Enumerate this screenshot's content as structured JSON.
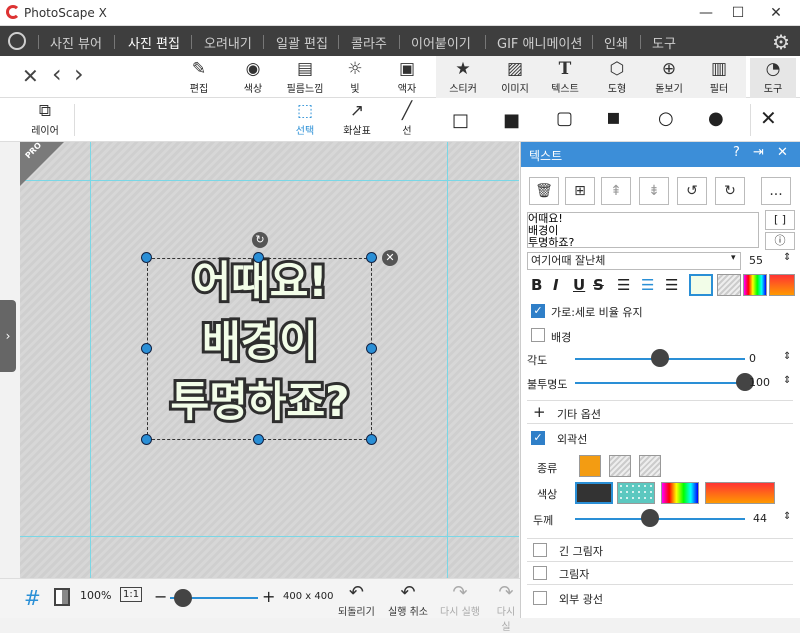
{
  "app": {
    "title": "PhotoScape X",
    "window": {
      "minimize": "—",
      "maximize": "☐",
      "close": "✕"
    }
  },
  "menu": {
    "items": [
      "사진 뷰어",
      "사진 편집",
      "오려내기",
      "일괄 편집",
      "콜라주",
      "이어붙이기",
      "GIF 애니메이션",
      "인쇄",
      "도구"
    ],
    "active": "사진 편집"
  },
  "toolbar": {
    "nav": {
      "close": "✕",
      "back": "‹",
      "forward": "›"
    },
    "tools": [
      {
        "label": "편집",
        "icon": "✎"
      },
      {
        "label": "색상",
        "icon": "◉"
      },
      {
        "label": "필름느낌",
        "icon": "▤"
      },
      {
        "label": "빛",
        "icon": "☼"
      },
      {
        "label": "액자",
        "icon": "▣"
      },
      {
        "label": "스티커",
        "icon": "★"
      },
      {
        "label": "이미지",
        "icon": "▨"
      },
      {
        "label": "텍스트",
        "icon": "T"
      },
      {
        "label": "도형",
        "icon": "⬡"
      },
      {
        "label": "돋보기",
        "icon": "⊕"
      },
      {
        "label": "필터",
        "icon": "▥"
      },
      {
        "label": "도구",
        "icon": "◔"
      }
    ]
  },
  "toolbar2": {
    "layer": "레이어",
    "select": "선택",
    "arrow": "화살표",
    "line": "선",
    "shapes": [
      "□",
      "■",
      "▢",
      "▪",
      "○",
      "●"
    ],
    "close": "✕"
  },
  "canvas": {
    "badge": "PRO",
    "text_lines": "어때요!\n배경이\n투명하죠?"
  },
  "bottom": {
    "zoom": "100%",
    "one_to_one": "1:1",
    "size": "400 x 400",
    "redo_all": "되돌리기",
    "undo": "실행 취소",
    "redo": "다시 실행",
    "redo2": "다시 실"
  },
  "panel": {
    "title": "텍스트",
    "text_value": "어때요!\n배경이\n투명하죠?",
    "bracket": "[ ]",
    "font": "여기어때 잘난체",
    "font_size": "55",
    "styles": [
      "B",
      "I",
      "U",
      "S"
    ],
    "keep_ratio": "가로:세로 비율 유지",
    "background": "배경",
    "angle_label": "각도",
    "angle_value": "0",
    "opacity_label": "불투명도",
    "opacity_value": "100",
    "more_options": "기타 옵션",
    "outline": "외곽선",
    "type_label": "종류",
    "color_label": "색상",
    "thickness_label": "두께",
    "thickness_value": "44",
    "long_shadow": "긴 그림자",
    "shadow": "그림자",
    "outer_glow": "외부 광선",
    "more": "..."
  },
  "colors": {
    "accent": "#3c8ed8",
    "menu_bg": "#3e3e3e",
    "outline_swatch": "#f39c12"
  },
  "controls": {
    "angle": 0.5,
    "opacity": 1.0,
    "thickness": 0.44,
    "zoom": 0.15
  }
}
